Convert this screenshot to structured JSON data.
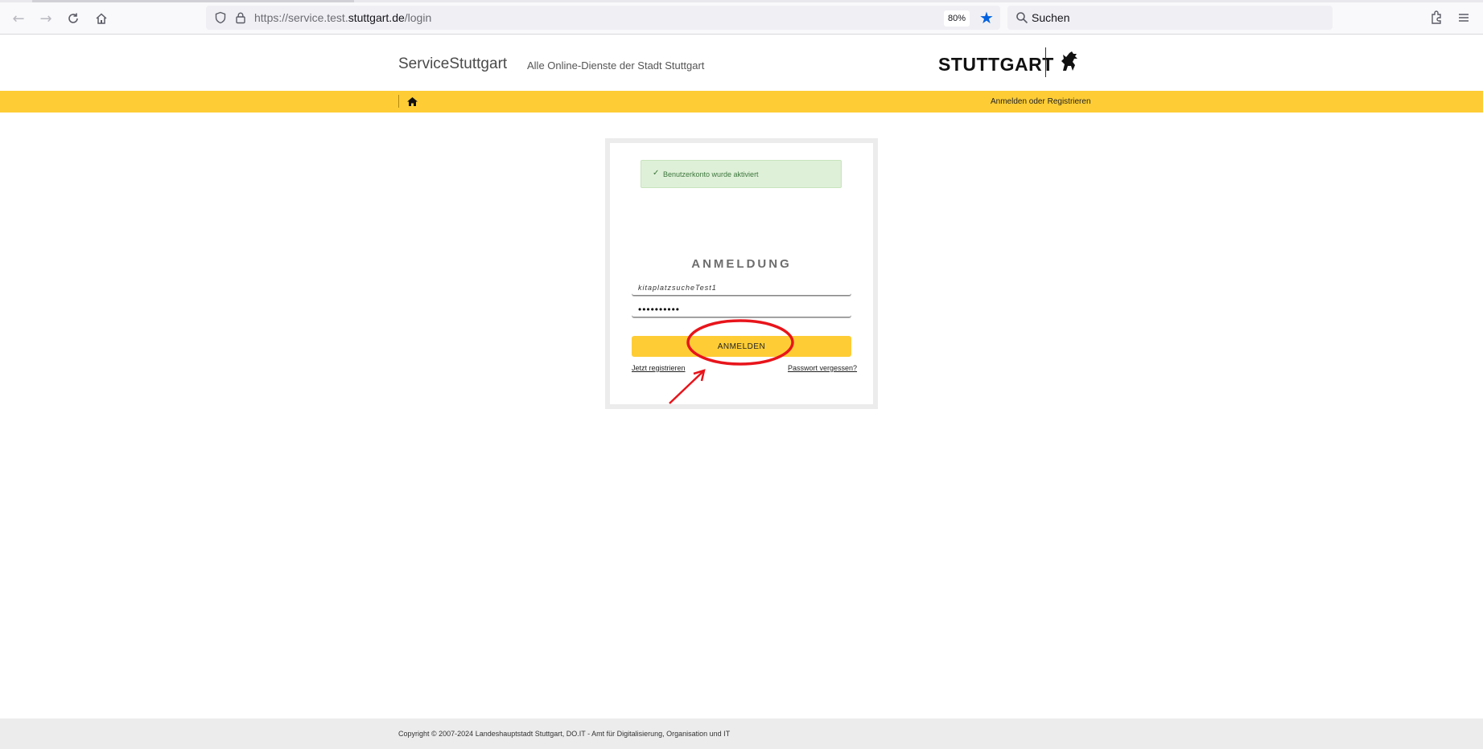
{
  "browser": {
    "url_prefix": "https://service.test.",
    "url_domain": "stuttgart.de",
    "url_path": "/login",
    "zoom": "80%",
    "search_placeholder": "Suchen"
  },
  "header": {
    "site_title": "ServiceStuttgart",
    "site_subtitle": "Alle Online-Dienste der Stadt Stuttgart",
    "logo_text": "STUTTGART"
  },
  "navbar": {
    "login_link": "Anmelden oder Registrieren"
  },
  "login": {
    "alert_message": "Benutzerkonto wurde aktiviert",
    "title": "ANMELDUNG",
    "username_value": "kitaplatzsucheTest1",
    "password_value": "••••••••••",
    "submit_label": "ANMELDEN",
    "register_link": "Jetzt registrieren",
    "forgot_link": "Passwort vergessen?"
  },
  "footer": {
    "copyright": "Copyright © 2007-2024 Landeshauptstadt Stuttgart, DO.IT - Amt für Digitalisierung, Organisation und IT"
  },
  "colors": {
    "brand_yellow": "#fecd36",
    "success_bg": "#dff0d8",
    "annotation_red": "#e8141b"
  }
}
